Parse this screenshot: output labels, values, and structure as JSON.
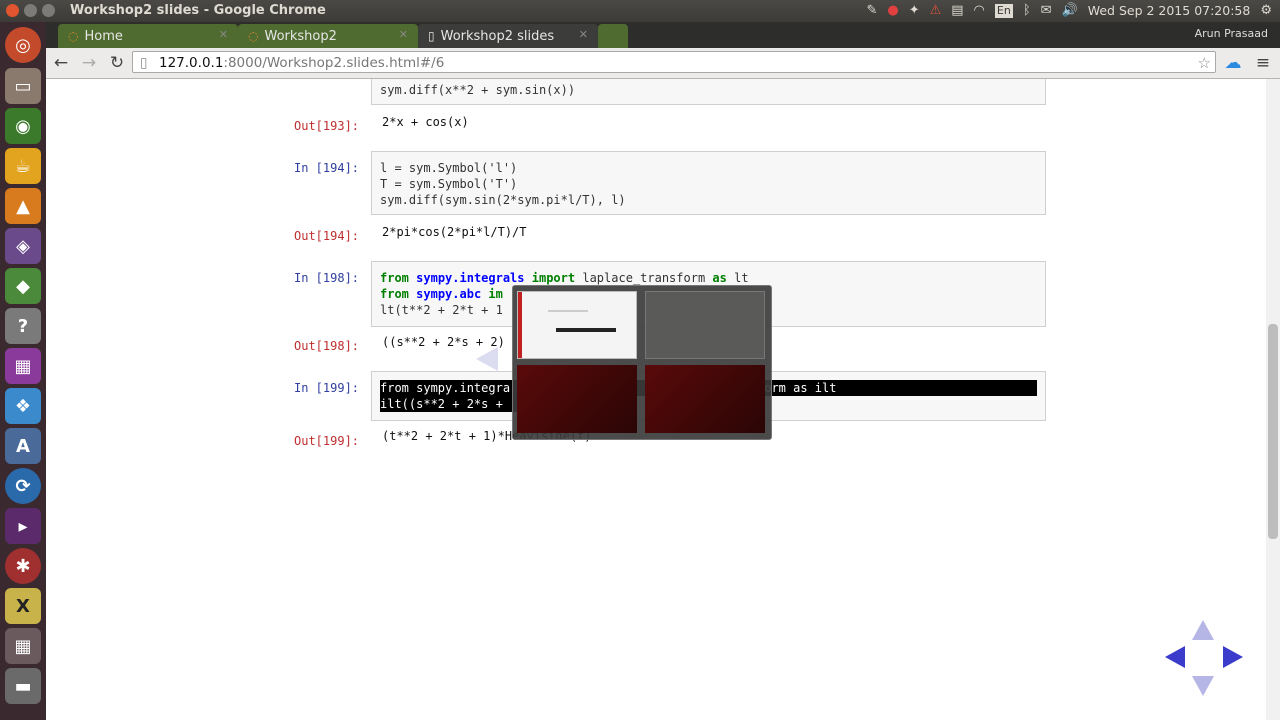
{
  "window": {
    "title": "Workshop2 slides - Google Chrome"
  },
  "tray": {
    "keyboard": "En",
    "clock": "Wed Sep  2 2015 07:20:58"
  },
  "tabs": [
    {
      "label": "Home",
      "active": false
    },
    {
      "label": "Workshop2",
      "active": false
    },
    {
      "label": "Workshop2 slides",
      "active": true
    }
  ],
  "profile": {
    "name": "Arun Prasaad"
  },
  "address": {
    "host": "127.0.0.1",
    "path": ":8000/Workshop2.slides.html#/6"
  },
  "notebook": {
    "cells": [
      {
        "code_lines": [
          "sym.diff(x**2 + sym.sin(x))"
        ]
      },
      {
        "out_prompt": "Out[193]:",
        "output": "2*x + cos(x)"
      },
      {
        "in_prompt": "In [194]:",
        "code_lines": [
          "l = sym.Symbol('l')",
          "T = sym.Symbol('T')",
          "sym.diff(sym.sin(2*sym.pi*l/T), l)"
        ]
      },
      {
        "out_prompt": "Out[194]:",
        "output": "2*pi*cos(2*pi*l/T)/T"
      },
      {
        "in_prompt": "In [198]:",
        "line1": {
          "kw_from": "from",
          "mod": "sympy.integrals",
          "kw_import": "import",
          "rest": "laplace_transform",
          "kw_as": "as",
          "alias": "lt"
        },
        "line2": {
          "kw_from": "from",
          "mod": "sympy.abc",
          "kw_import": "im"
        },
        "line3": "lt(t**2 + 2*t + 1"
      },
      {
        "out_prompt": "Out[198]:",
        "output": "((s**2 + 2*s + 2)"
      },
      {
        "in_prompt": "In [199]:",
        "line1_a": "from sympy.integra",
        "line1_b": "form as ilt",
        "line2": "ilt((s**2 + 2*s +"
      },
      {
        "out_prompt": "Out[199]:",
        "output": "(t**2 + 2*t + 1)*Heaviside(t)"
      }
    ]
  },
  "colors": {
    "accent_nav": "#3b3bcc",
    "nav_disabled": "#b6b6e6"
  }
}
